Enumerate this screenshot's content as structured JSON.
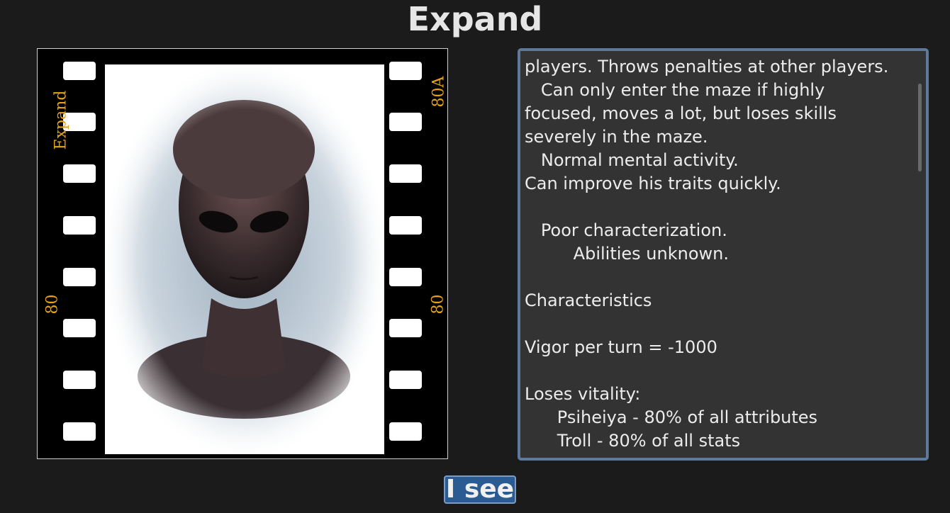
{
  "dialog": {
    "title": "Expand",
    "film_labels": {
      "left_top": "Expand",
      "left_bottom": "80",
      "right_top": "80A",
      "right_bottom": "80"
    },
    "description_lines": [
      "players. Throws penalties at other players.",
      "   Can only enter the maze if highly",
      "focused, moves a lot, but loses skills",
      "severely in the maze.",
      "   Normal mental activity.",
      "Can improve his traits quickly.",
      "",
      "   Poor characterization.",
      "         Abilities unknown.",
      "",
      "Characteristics",
      "",
      "Vigor per turn = -1000",
      "",
      "Loses vitality:",
      "      Psiheiya - 80% of all attributes",
      "      Troll - 80% of all stats"
    ],
    "confirm_label": "I see"
  }
}
